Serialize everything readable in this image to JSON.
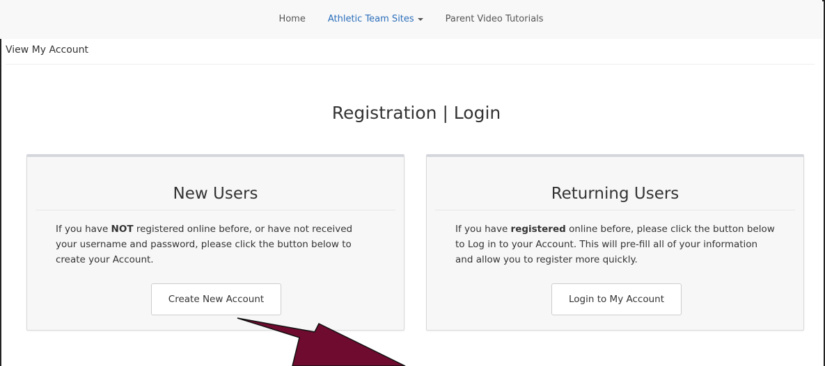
{
  "nav": {
    "items": [
      {
        "label": "Home"
      },
      {
        "label": "Athletic Team Sites"
      },
      {
        "label": "Parent Video Tutorials"
      }
    ]
  },
  "account_bar": {
    "label": "View My Account"
  },
  "page": {
    "title": "Registration | Login"
  },
  "new_users": {
    "title": "New Users",
    "text_before": "If you have ",
    "text_bold": "NOT",
    "text_after": " registered online before, or have not received your username and password, please click the button below to create your Account.",
    "button_label": "Create New Account"
  },
  "returning_users": {
    "title": "Returning Users",
    "text_before": "If you have ",
    "text_bold": "registered",
    "text_after": " online before, please click the button below to Log in to your Account. This will pre-fill all of your information and allow you to register more quickly.",
    "button_label": "Login to My Account"
  },
  "colors": {
    "active_nav": "#2a6ebb",
    "annotation_arrow": "#6e0b2e"
  }
}
